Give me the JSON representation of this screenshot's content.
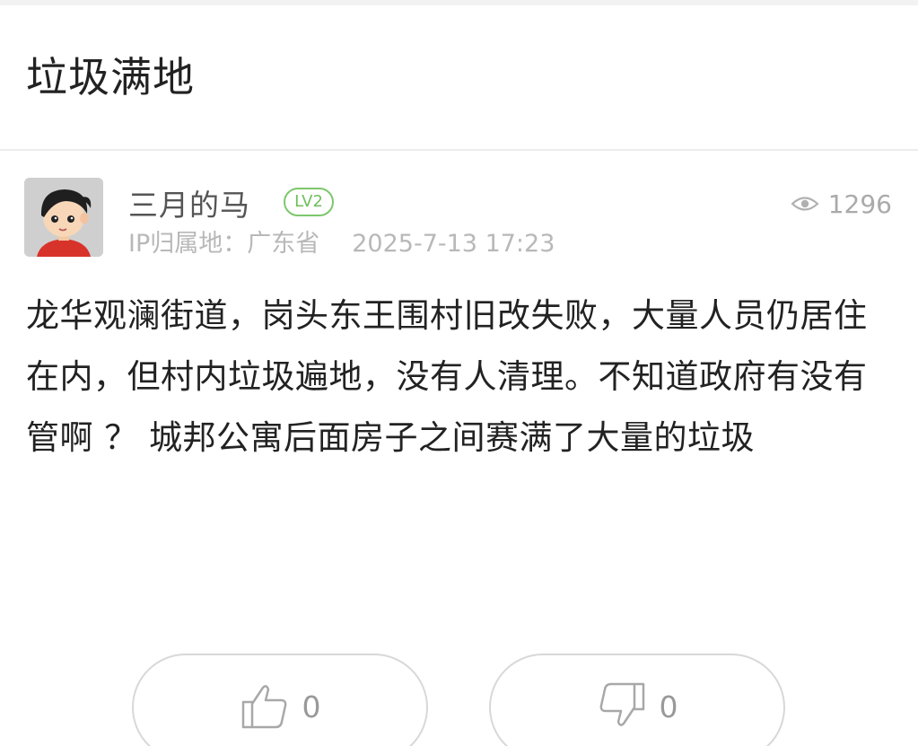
{
  "post": {
    "title": "垃圾满地",
    "author": {
      "name": "三月的马",
      "level": "LV2",
      "ip_label": "IP归属地：广东省",
      "date": "2025-7-13 17:23"
    },
    "views": "1296",
    "body": "龙华观澜街道，岗头东王围村旧改失败，大量人员仍居住在内，但村内垃圾遍地，没有人清理。不知道政府有没有管啊 ？  城邦公寓后面房子之间赛满了大量的垃圾"
  },
  "actions": {
    "like_count": "0",
    "dislike_count": "0"
  },
  "icons": {
    "views": "eye-icon",
    "like": "thumbs-up-icon",
    "dislike": "thumbs-down-icon"
  },
  "colors": {
    "level_badge": "#7cc86b",
    "meta_text": "#b8b8b8",
    "body_text": "#222222"
  }
}
